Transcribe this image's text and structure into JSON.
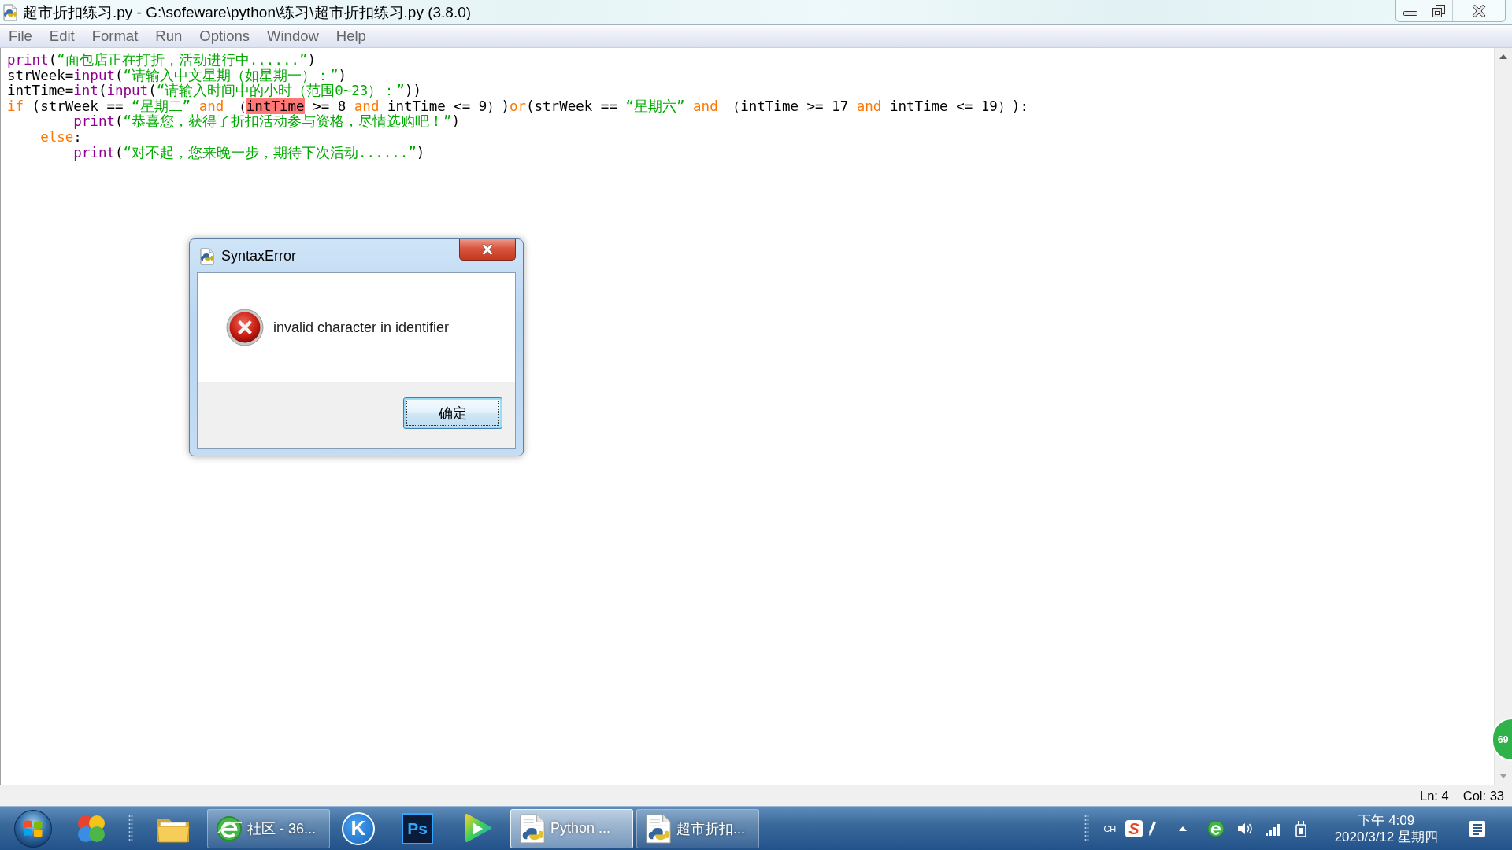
{
  "window": {
    "title": "超市折扣练习.py - G:\\sofeware\\python\\练习\\超市折扣练习.py (3.8.0)"
  },
  "menu": [
    "File",
    "Edit",
    "Format",
    "Run",
    "Options",
    "Window",
    "Help"
  ],
  "editor": {
    "lines": [
      {
        "tokens": [
          {
            "kind": "builtin",
            "text": "print"
          },
          {
            "kind": "plain",
            "text": "("
          },
          {
            "kind": "string",
            "text": "“面包店正在打折，活动进行中......”"
          },
          {
            "kind": "plain",
            "text": ")"
          }
        ]
      },
      {
        "tokens": [
          {
            "kind": "plain",
            "text": "strWeek="
          },
          {
            "kind": "builtin",
            "text": "input"
          },
          {
            "kind": "plain",
            "text": "("
          },
          {
            "kind": "string",
            "text": "“请输入中文星期（如星期一）：”"
          },
          {
            "kind": "plain",
            "text": ")"
          }
        ]
      },
      {
        "tokens": [
          {
            "kind": "plain",
            "text": "intTime="
          },
          {
            "kind": "builtin",
            "text": "int"
          },
          {
            "kind": "plain",
            "text": "("
          },
          {
            "kind": "builtin",
            "text": "input"
          },
          {
            "kind": "plain",
            "text": "("
          },
          {
            "kind": "string",
            "text": "“请输入时间中的小时（范围0~23）：”"
          },
          {
            "kind": "plain",
            "text": "))"
          }
        ]
      },
      {
        "tokens": [
          {
            "kind": "keyword",
            "text": "if"
          },
          {
            "kind": "plain",
            "text": " (strWeek == "
          },
          {
            "kind": "string",
            "text": "“星期二”"
          },
          {
            "kind": "keyword",
            "text": " and"
          },
          {
            "kind": "plain",
            "text": " （"
          },
          {
            "kind": "error",
            "text": "intTime"
          },
          {
            "kind": "plain",
            "text": " >= 8 "
          },
          {
            "kind": "keyword",
            "text": "and"
          },
          {
            "kind": "plain",
            "text": " intTime <= 9）)"
          },
          {
            "kind": "keyword",
            "text": "or"
          },
          {
            "kind": "plain",
            "text": "(strWeek == "
          },
          {
            "kind": "string",
            "text": "“星期六”"
          },
          {
            "kind": "keyword",
            "text": " and"
          },
          {
            "kind": "plain",
            "text": " （intTime >= 17 "
          },
          {
            "kind": "keyword",
            "text": "and"
          },
          {
            "kind": "plain",
            "text": " intTime <= 19）):"
          }
        ]
      },
      {
        "tokens": [
          {
            "kind": "builtin",
            "text": "        print"
          },
          {
            "kind": "plain",
            "text": "("
          },
          {
            "kind": "string",
            "text": "“恭喜您，获得了折扣活动参与资格，尽情选购吧！”"
          },
          {
            "kind": "plain",
            "text": ")"
          }
        ]
      },
      {
        "tokens": [
          {
            "kind": "keyword",
            "text": "    else"
          },
          {
            "kind": "plain",
            "text": ":"
          }
        ]
      },
      {
        "tokens": [
          {
            "kind": "builtin",
            "text": "        print"
          },
          {
            "kind": "plain",
            "text": "("
          },
          {
            "kind": "string",
            "text": "“对不起，您来晚一步，期待下次活动......”"
          },
          {
            "kind": "plain",
            "text": ")"
          }
        ]
      }
    ]
  },
  "dialog": {
    "title": "SyntaxError",
    "message": "invalid character in identifier",
    "button": "确定"
  },
  "status_bar": {
    "line": "Ln: 4",
    "column": "Col: 33"
  },
  "side_widget": {
    "count": "69"
  },
  "taskbar": {
    "quick_launch": [
      {
        "kind": "colorballs"
      }
    ],
    "buttons": [
      {
        "kind": "folder",
        "selected": false
      },
      {
        "kind": "webwindow",
        "label": "社区 - 36...",
        "selected": false
      },
      {
        "kind": "roundlogo",
        "logo": "K",
        "selected": false
      },
      {
        "kind": "squarelogo",
        "logo": "Ps",
        "selected": false
      },
      {
        "kind": "player",
        "selected": false
      },
      {
        "kind": "pywindow",
        "label": "Python ...",
        "selected": true
      },
      {
        "kind": "pywindow",
        "label": "超市折扣...",
        "selected": false
      }
    ],
    "tray": {
      "input_language": "CH",
      "ime_logo": "S",
      "time": "下午 4:09",
      "date": "2020/3/12 星期四"
    }
  }
}
